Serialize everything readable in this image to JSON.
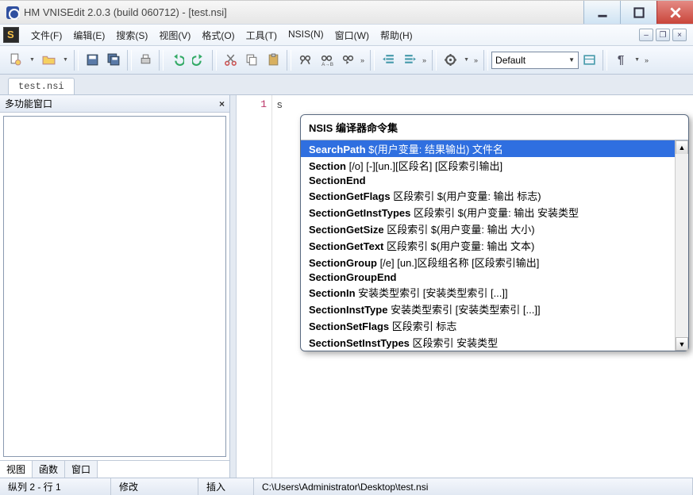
{
  "window": {
    "title": "HM VNISEdit 2.0.3 (build 060712) - [test.nsi]"
  },
  "menus": [
    {
      "key": "file",
      "label": "文件(F)"
    },
    {
      "key": "edit",
      "label": "编辑(E)"
    },
    {
      "key": "search",
      "label": "搜索(S)"
    },
    {
      "key": "view",
      "label": "视图(V)"
    },
    {
      "key": "format",
      "label": "格式(O)"
    },
    {
      "key": "tools",
      "label": "工具(T)"
    },
    {
      "key": "nsis",
      "label": "NSIS(N)"
    },
    {
      "key": "window",
      "label": "窗口(W)"
    },
    {
      "key": "help",
      "label": "帮助(H)"
    }
  ],
  "toolbar": {
    "new": "new",
    "newmenu": "new-menu",
    "open": "open",
    "openmenu": "open-menu",
    "save": "save",
    "saveall": "save-all",
    "print": "print",
    "undo": "undo",
    "redo": "redo",
    "cut": "cut",
    "copy": "copy",
    "paste": "paste",
    "find": "find",
    "replace": "replace",
    "findnext": "find-next",
    "indent": "indent",
    "unindent": "unindent",
    "compile": "compile",
    "compilemenu": "compile-menu",
    "preset_label": "Default",
    "paragraph": "¶"
  },
  "tabs": {
    "file": "test.nsi"
  },
  "left_panel": {
    "title": "多功能窗口",
    "tabs": [
      "视图",
      "函数",
      "窗口"
    ]
  },
  "editor": {
    "line_number": "1",
    "typed": "s"
  },
  "autocomplete": {
    "header": "NSIS 编译器命令集",
    "items": [
      {
        "cmd": "SearchPath",
        "args": "$(用户变量: 结果输出) 文件名"
      },
      {
        "cmd": "Section",
        "args": "[/o] [-][un.][区段名] [区段索引输出]"
      },
      {
        "cmd": "SectionEnd",
        "args": ""
      },
      {
        "cmd": "SectionGetFlags",
        "args": "区段索引 $(用户变量: 输出 标志)"
      },
      {
        "cmd": "SectionGetInstTypes",
        "args": "区段索引 $(用户变量: 输出 安装类型"
      },
      {
        "cmd": "SectionGetSize",
        "args": "区段索引 $(用户变量: 输出 大小)"
      },
      {
        "cmd": "SectionGetText",
        "args": "区段索引 $(用户变量: 输出 文本)"
      },
      {
        "cmd": "SectionGroup",
        "args": "[/e] [un.]区段组名称 [区段索引输出]"
      },
      {
        "cmd": "SectionGroupEnd",
        "args": ""
      },
      {
        "cmd": "SectionIn",
        "args": "安装类型索引 [安装类型索引 [...]]"
      },
      {
        "cmd": "SectionInstType",
        "args": "安装类型索引 [安装类型索引 [...]]"
      },
      {
        "cmd": "SectionSetFlags",
        "args": "区段索引 标志"
      },
      {
        "cmd": "SectionSetInstTypes",
        "args": "区段索引 安装类型"
      }
    ],
    "selected_index": 0
  },
  "status": {
    "pos": "纵列 2 - 行 1",
    "mode1": "修改",
    "mode2": "插入",
    "path": "C:\\Users\\Administrator\\Desktop\\test.nsi"
  }
}
